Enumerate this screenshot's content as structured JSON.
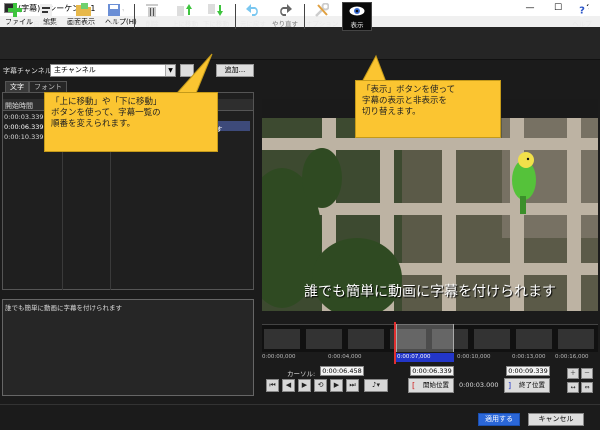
{
  "window": {
    "title": "(字幕) - シーケンス 1",
    "minimize_glyph": "—",
    "maximize_glyph": "☐",
    "close_glyph": "✕"
  },
  "menu": [
    "ファイル",
    "編集",
    "画面表示",
    "ヘルプ(H)"
  ],
  "toolbar": {
    "insert": "挿入",
    "auto_create": "自動作成",
    "import": "読み込む",
    "save": "保存",
    "delete": "削除",
    "move_up": "上に移動",
    "move_down": "下に移動",
    "undo": "元に戻す",
    "redo": "やり直す",
    "options": "オプション",
    "show": "表示",
    "help": "ヘルプ"
  },
  "channel": {
    "label": "字幕チャンネル:",
    "value": "主チャンネル",
    "add_label": "追加..."
  },
  "tabs": {
    "text": "文字",
    "font": "フォント"
  },
  "list": {
    "header_start": "開始時間",
    "rows": [
      {
        "start": "0:00:03.339"
      },
      {
        "start": "0:00:06.339",
        "text": "す"
      },
      {
        "start": "0:00:10.339"
      }
    ]
  },
  "editor": {
    "text": "誰でも簡単に動画に字幕を付けられます"
  },
  "preview": {
    "subtitle": "誰でも簡単に動画に字幕を付けられます"
  },
  "timeline": {
    "ticks": [
      "0:00:00,000",
      "0:00:04,000",
      "0:00:07,000",
      "0:00:10,000",
      "0:00:13,000",
      "0:00:16,000"
    ]
  },
  "controls": {
    "cursor_label": "カーソル:",
    "cursor_value": "0:00:06.458",
    "start_value": "0:00:06.339",
    "end_value": "0:00:09.339",
    "duration": "0:00:03.000",
    "start_button": "開始位置",
    "end_button": "終了位置"
  },
  "footer": {
    "apply": "適用する",
    "cancel": "キャンセル"
  },
  "callouts": {
    "move": [
      "「上に移動」や「下に移動」",
      "ボタンを使って、字幕一覧の",
      "順番を変えられます。"
    ],
    "show": [
      "「表示」ボタンを使って",
      "字幕の表示と非表示を",
      "切り替えます。"
    ]
  },
  "colors": {
    "accent": "#2336c8",
    "callout": "#fbc531",
    "playhead": "#e03030"
  }
}
